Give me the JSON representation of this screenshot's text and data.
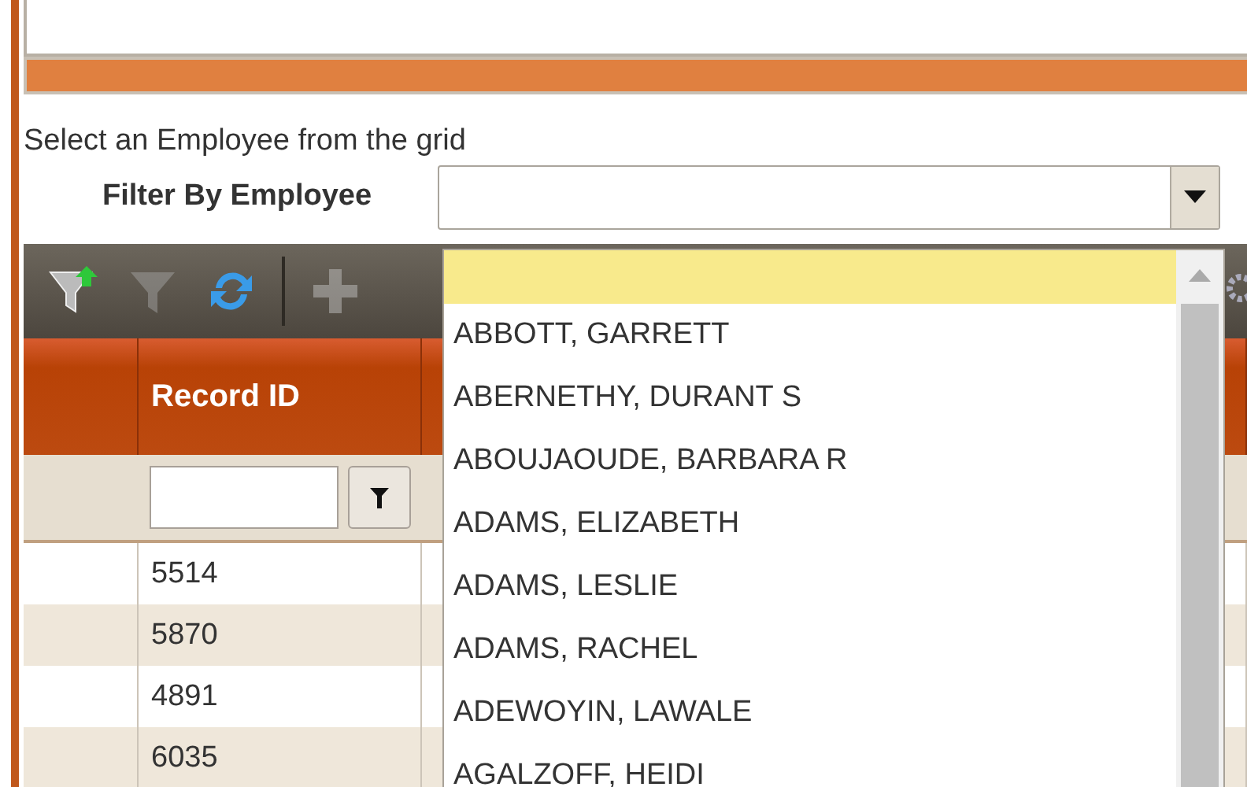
{
  "instruction": "Select an Employee from the grid",
  "filter": {
    "label": "Filter By Employee",
    "dropdown": {
      "expanded": true,
      "items": [
        {
          "selected": true
        },
        {
          "label": "ABBOTT, GARRETT",
          "selected": false
        },
        {
          "label": "ABERNETHY, DURANT S",
          "selected": false
        },
        {
          "label": "ABOUJAOUDE, BARBARA R",
          "selected": false
        },
        {
          "label": "ADAMS, ELIZABETH",
          "selected": false
        },
        {
          "label": "ADAMS, LESLIE",
          "selected": false
        },
        {
          "label": "ADAMS, RACHEL",
          "selected": false
        },
        {
          "label": "ADEWOYIN, LAWALE",
          "selected": false
        },
        {
          "label": "AGALZOFF, HEIDI",
          "selected": false
        }
      ]
    }
  },
  "toolbar": {
    "items": [
      {
        "kind": "filter-add",
        "disabled": false
      },
      {
        "kind": "filter-clear",
        "disabled": true
      },
      {
        "kind": "refresh",
        "disabled": false
      },
      {
        "kind": "separator"
      },
      {
        "kind": "add",
        "disabled": true
      }
    ]
  },
  "table": {
    "columns": [
      "Record ID"
    ],
    "rows": [
      {
        "record_id": "5514"
      },
      {
        "record_id": "5870"
      },
      {
        "record_id": "4891"
      },
      {
        "record_id": "6035"
      }
    ]
  }
}
